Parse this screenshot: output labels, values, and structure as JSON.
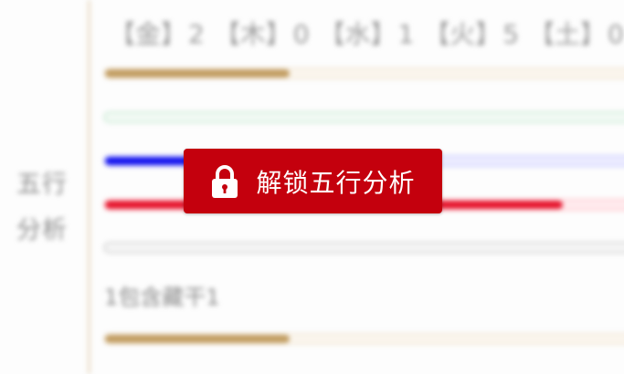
{
  "sidebar": {
    "label_line1": "五行",
    "label_line2": "分析"
  },
  "elements_counts": [
    {
      "element": "【金】",
      "count": "2"
    },
    {
      "element": "【木】",
      "count": "0"
    },
    {
      "element": "【水】",
      "count": "1"
    },
    {
      "element": "【火】",
      "count": "5"
    },
    {
      "element": "【土】",
      "count": "0"
    }
  ],
  "bars": [
    {
      "name": "gold-bar",
      "level": 0.35,
      "color": "#c29d62"
    },
    {
      "name": "green-bar",
      "level": 0,
      "color": "#2fae5c"
    },
    {
      "name": "blue-bar",
      "level": 0.17,
      "color": "#1414ee"
    },
    {
      "name": "red-bar",
      "level": 0.87,
      "color": "#e5152d"
    },
    {
      "name": "gray-bar",
      "level": 0,
      "color": "#999999"
    }
  ],
  "hint_text": "1包含藏干1",
  "bottom_bar": {
    "level": 0.35,
    "color": "#c29d62"
  },
  "overlay": {
    "unlock_label": "解锁五行分析",
    "icon": "lock-icon",
    "accent_color": "#c4000d"
  }
}
